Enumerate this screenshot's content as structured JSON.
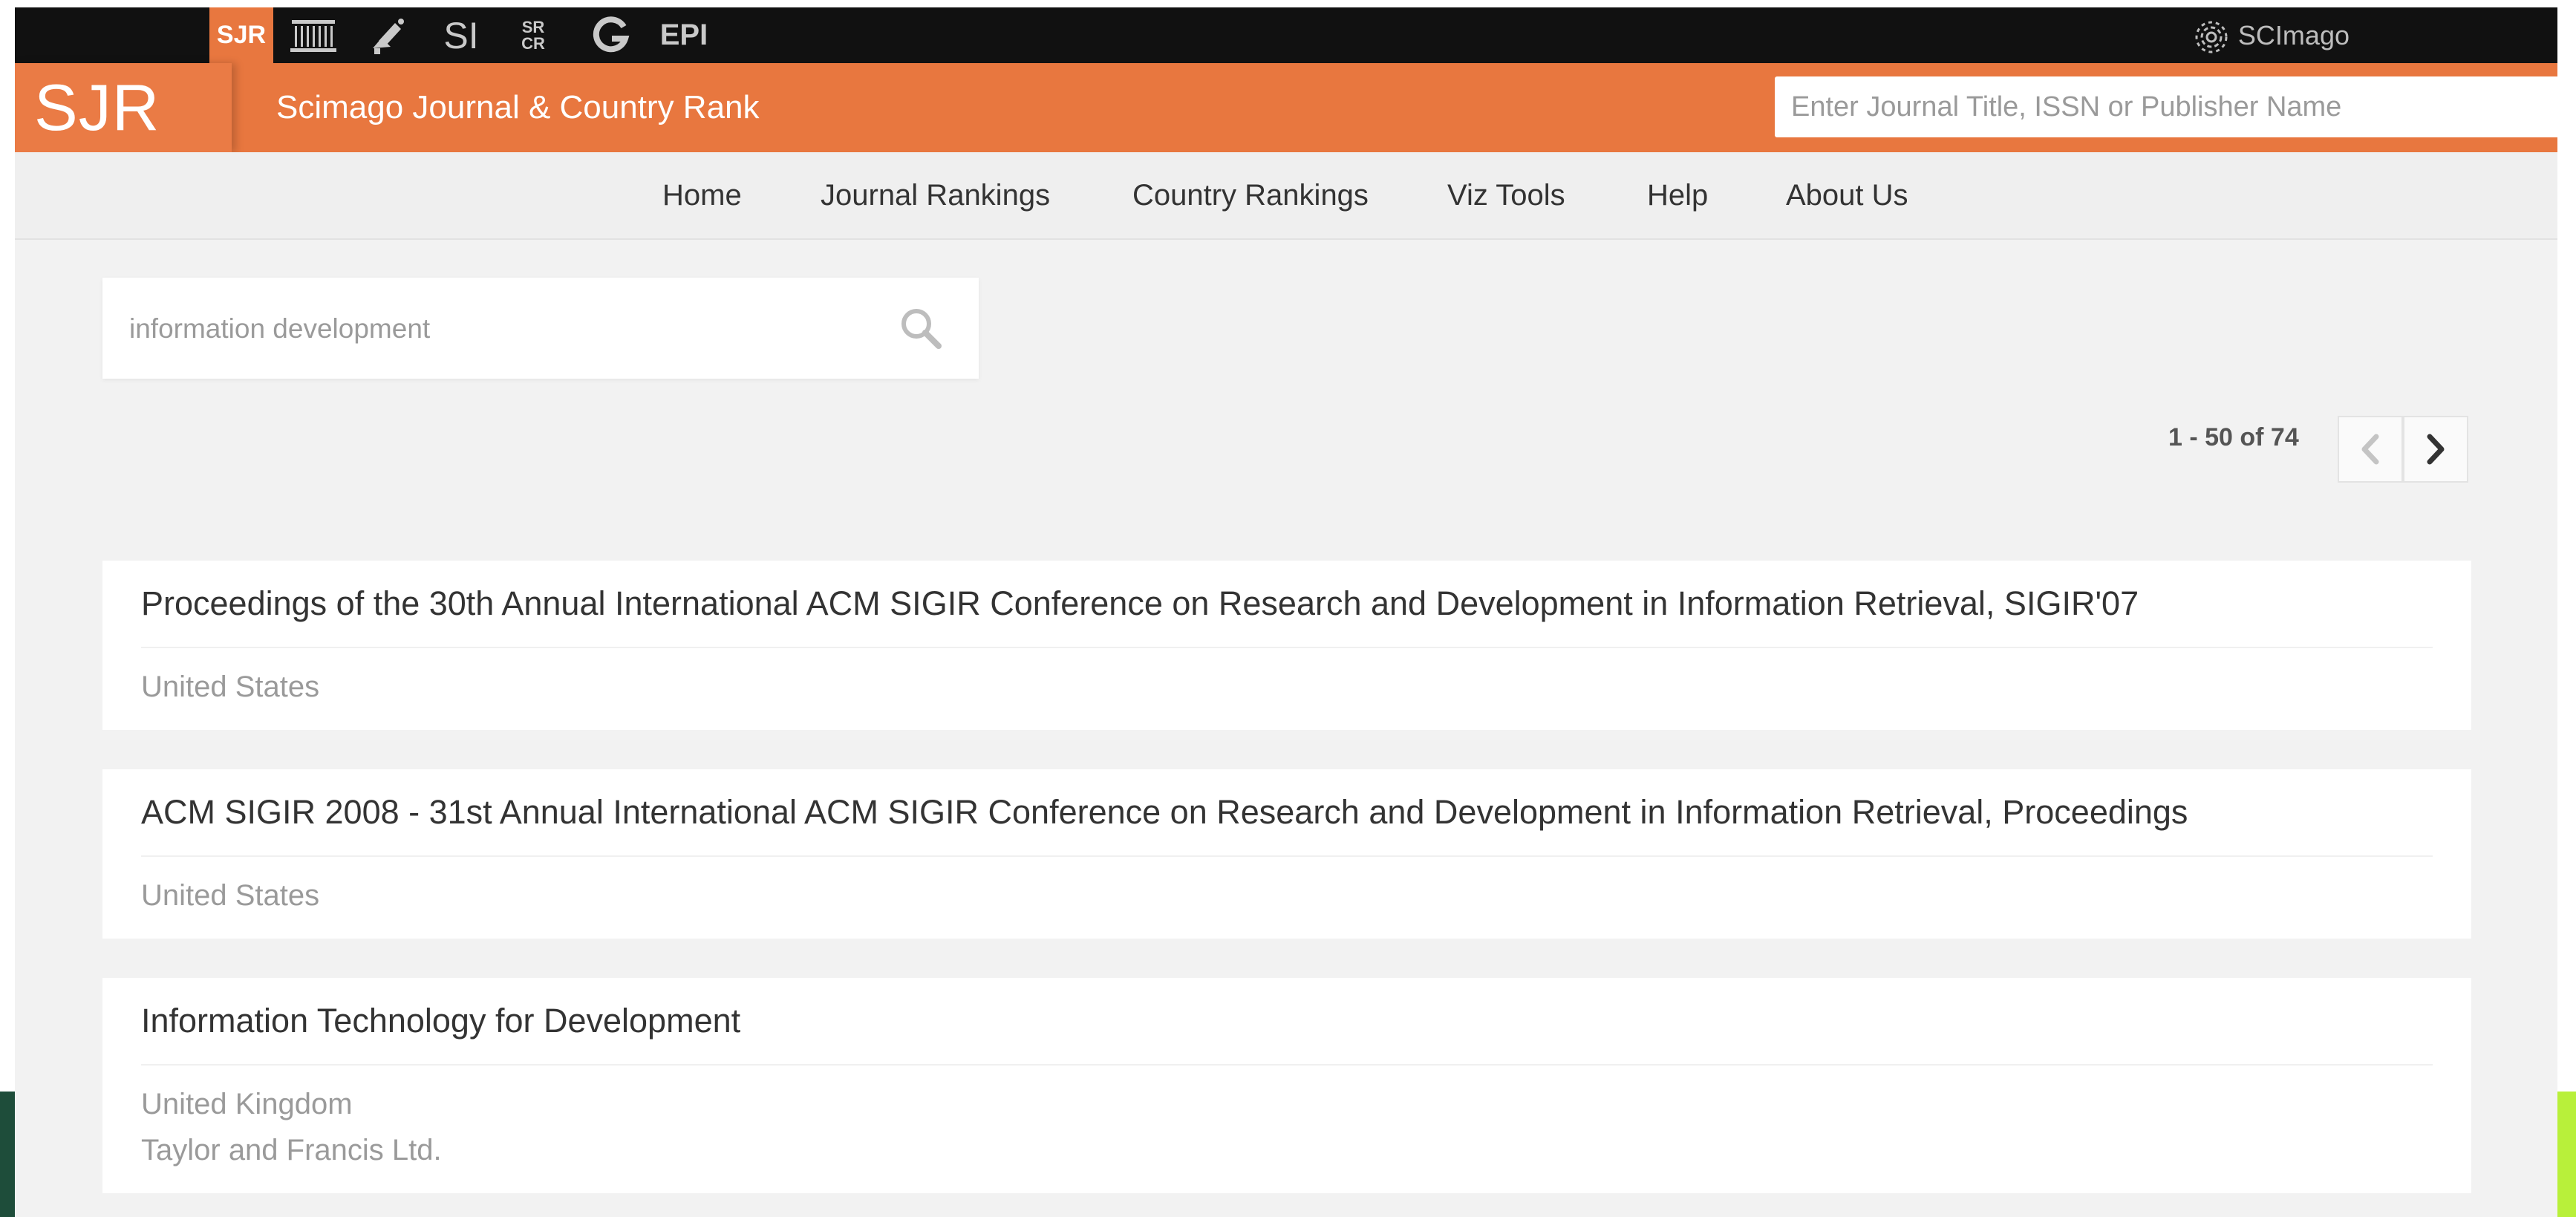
{
  "topbar": {
    "tabs": [
      {
        "label": "SJR",
        "active": true
      },
      {
        "icon": "institution-icon"
      },
      {
        "icon": "megaphone-icon"
      },
      {
        "label": "SI"
      },
      {
        "label": "SR\nCR"
      },
      {
        "icon": "g-logo-icon"
      },
      {
        "label": "EPI"
      }
    ],
    "brand_right": "SCImago"
  },
  "header": {
    "logo": "SJR",
    "title": "Scimago Journal & Country Rank",
    "search_placeholder": "Enter Journal Title, ISSN or Publisher Name"
  },
  "nav": {
    "items": [
      "Home",
      "Journal Rankings",
      "Country Rankings",
      "Viz Tools",
      "Help",
      "About Us"
    ]
  },
  "search": {
    "value": "",
    "placeholder": "information development"
  },
  "pagination": {
    "text": "1 - 50 of 74"
  },
  "results": [
    {
      "title": "Proceedings of the 30th Annual International ACM SIGIR Conference on Research and Development in Information Retrieval, SIGIR'07",
      "country": "United States",
      "publisher": ""
    },
    {
      "title": "ACM SIGIR 2008 - 31st Annual International ACM SIGIR Conference on Research and Development in Information Retrieval, Proceedings",
      "country": "United States",
      "publisher": ""
    },
    {
      "title": "Information Technology for Development",
      "country": "United Kingdom",
      "publisher": "Taylor and Francis Ltd."
    }
  ],
  "colors": {
    "brand_orange": "#e8773f",
    "topbar_black": "#111111",
    "page_bg": "#f2f2f2"
  }
}
